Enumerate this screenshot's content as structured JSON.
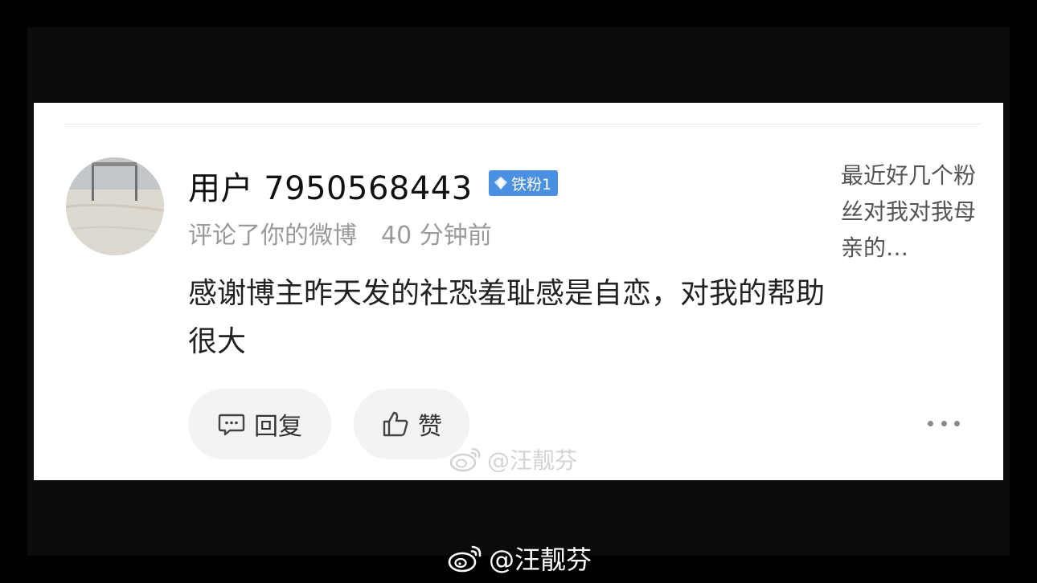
{
  "comment_card": {
    "username": "用户 7950568443",
    "badge_label": "铁粉1",
    "action_text": "评论了你的微博",
    "time_ago": "40 分钟前",
    "comment_text": "感谢博主昨天发的社恐羞耻感是自恋，对我的帮助很大",
    "original_post_preview": "最近好几个粉丝对我对我母亲的…",
    "reply_label": "回复",
    "like_label": "赞"
  },
  "watermarks": {
    "card": "@汪靓芬",
    "bottom": "@汪靓芬"
  },
  "colors": {
    "badge": "#4a90e2",
    "meta_text": "#9a9a9a",
    "button_bg": "#f3f3f3"
  },
  "icons": [
    "reply-icon",
    "thumbs-up-icon",
    "more-icon",
    "weibo-logo-icon",
    "diamond-icon"
  ]
}
